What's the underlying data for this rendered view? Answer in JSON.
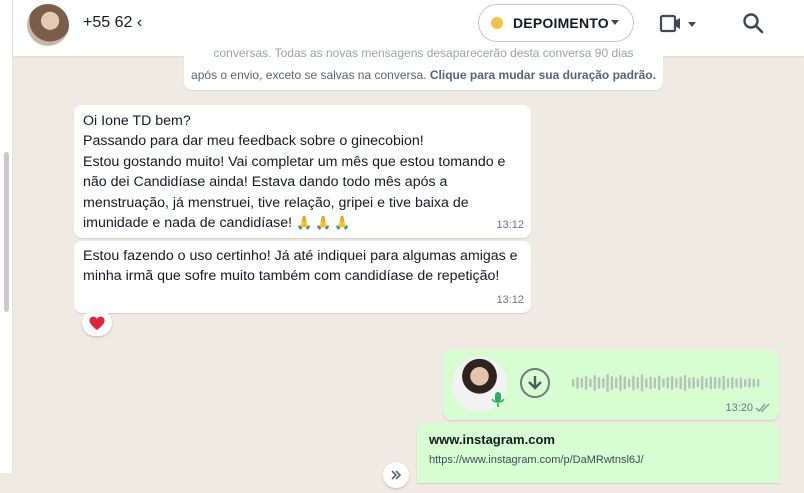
{
  "header": {
    "contact_name": "+55 62 ‹",
    "label": "DEPOIMENTO"
  },
  "system_notice": {
    "top_line": "conversas. Todas as novas mensagens desaparecerão desta conversa 90 dias",
    "bottom_line": "após o envio, exceto se salvas na conversa.",
    "action": "Clique para mudar sua duração padrão."
  },
  "messages": [
    {
      "lines": [
        "Oi Ione TD bem?",
        "Passando para dar meu feedback sobre o ginecobion!",
        "Estou gostando muito! Vai completar um mês que estou tomando e",
        "não dei Candidíase ainda! Estava dando todo mês após a",
        "menstruação, já menstruei, tive relação, gripei e tive baixa de",
        "imunidade e nada de candidíase!"
      ],
      "emoji": "🙏🙏🙏",
      "time": "13:12"
    },
    {
      "lines": [
        "Estou fazendo o uso certinho! Já até indiquei para algumas amigas e",
        "minha irmã que sofre muito também com candidíase de repetição!"
      ],
      "time": "13:12"
    }
  ],
  "reaction": "❤️",
  "voice_message": {
    "time": "13:20"
  },
  "link_preview": {
    "title": "www.instagram.com",
    "url": "https://www.instagram.com/p/DaMRwtnsl6J/"
  },
  "colors": {
    "chat_background": "#efeae2",
    "incoming_bubble": "#ffffff",
    "outgoing_bubble": "#d9fdd3",
    "label_dot": "#f5c343"
  }
}
